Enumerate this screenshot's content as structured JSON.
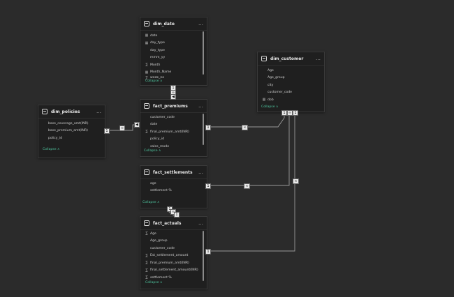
{
  "tables": {
    "dim_date": {
      "title": "dim_date",
      "more": "…",
      "fields": [
        {
          "icon": "calendar-icon",
          "glyph": "▦",
          "name": "date"
        },
        {
          "icon": "calendar-icon",
          "glyph": "▦",
          "name": "day_type"
        },
        {
          "icon": "none",
          "glyph": "",
          "name": "day_type"
        },
        {
          "icon": "none",
          "glyph": "",
          "name": "mmm_yy"
        },
        {
          "icon": "sigma-icon",
          "glyph": "∑",
          "name": "Month"
        },
        {
          "icon": "calendar-icon",
          "glyph": "▦",
          "name": "Month_Name"
        },
        {
          "icon": "sigma-icon",
          "glyph": "∑",
          "name": "week_no"
        }
      ],
      "collapse": "Collapse ∧"
    },
    "dim_customer": {
      "title": "dim_customer",
      "more": "…",
      "fields": [
        {
          "icon": "none",
          "glyph": "",
          "name": "Age"
        },
        {
          "icon": "none",
          "glyph": "",
          "name": "Age_group"
        },
        {
          "icon": "none",
          "glyph": "",
          "name": "city"
        },
        {
          "icon": "none",
          "glyph": "",
          "name": "customer_code"
        },
        {
          "icon": "calendar-icon",
          "glyph": "▦",
          "name": "dob"
        }
      ],
      "collapse": "Collapse ∧"
    },
    "dim_policies": {
      "title": "dim_policies",
      "more": "…",
      "fields": [
        {
          "icon": "none",
          "glyph": "",
          "name": "base_coverage_amt(INR)"
        },
        {
          "icon": "none",
          "glyph": "",
          "name": "base_premium_amt(INR)"
        },
        {
          "icon": "none",
          "glyph": "",
          "name": "policy_id"
        }
      ],
      "collapse": "Collapse ∧"
    },
    "fact_premiums": {
      "title": "fact_premiums",
      "more": "…",
      "fields": [
        {
          "icon": "none",
          "glyph": "",
          "name": "customer_code"
        },
        {
          "icon": "none",
          "glyph": "",
          "name": "date"
        },
        {
          "icon": "sigma-icon",
          "glyph": "∑",
          "name": "final_premium_amt(INR)"
        },
        {
          "icon": "none",
          "glyph": "",
          "name": "policy_id"
        },
        {
          "icon": "none",
          "glyph": "",
          "name": "sales_mode"
        }
      ],
      "collapse": "Collapse ∧"
    },
    "fact_settlements": {
      "title": "fact_settlements",
      "more": "…",
      "fields": [
        {
          "icon": "none",
          "glyph": "",
          "name": "age"
        },
        {
          "icon": "none",
          "glyph": "",
          "name": "settlement %"
        }
      ],
      "collapse": "Collapse ∧"
    },
    "fact_actuals": {
      "title": "fact_actuals",
      "more": "…",
      "fields": [
        {
          "icon": "sigma-icon",
          "glyph": "∑",
          "name": "Age"
        },
        {
          "icon": "none",
          "glyph": "",
          "name": "Age_group"
        },
        {
          "icon": "none",
          "glyph": "",
          "name": "customer_code"
        },
        {
          "icon": "sigma-icon",
          "glyph": "∑",
          "name": "Est_settlement_amount"
        },
        {
          "icon": "sigma-icon",
          "glyph": "∑",
          "name": "final_premium_amt(INR)"
        },
        {
          "icon": "sigma-icon",
          "glyph": "∑",
          "name": "final_settlement_amount(INR)"
        },
        {
          "icon": "sigma-icon",
          "glyph": "∑",
          "name": "settlement %"
        }
      ],
      "collapse": "Collapse ∧"
    }
  },
  "cardinality": {
    "one": "1",
    "many": "∞",
    "filter_arrow": "◀"
  }
}
